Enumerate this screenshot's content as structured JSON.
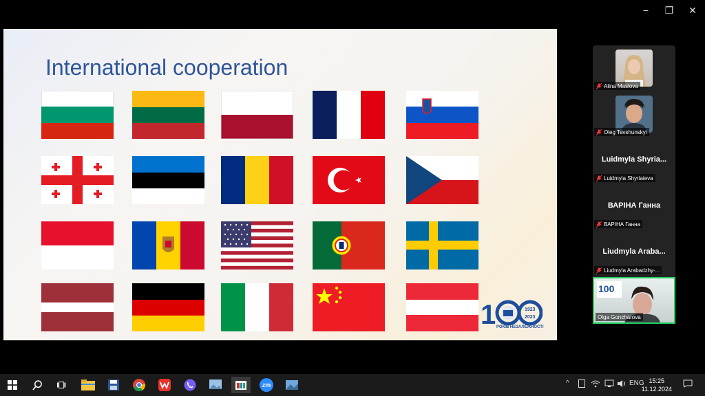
{
  "window": {
    "minimize_glyph": "−",
    "restore_glyph": "❐",
    "close_glyph": "✕"
  },
  "slide": {
    "title": "International cooperation",
    "flags": [
      "bulgaria-flag",
      "lithuania-flag",
      "poland-flag",
      "france-flag",
      "slovenia-flag",
      "georgia-flag",
      "estonia-flag",
      "romania-flag",
      "turkey-flag",
      "czech-flag",
      "monaco-flag",
      "moldova-flag",
      "usa-flag",
      "portugal-flag",
      "sweden-flag",
      "latvia-flag",
      "germany-flag",
      "italy-flag",
      "china-flag",
      "austria-flag"
    ],
    "logo": {
      "years_top": "1923",
      "years_bottom": "2023",
      "caption": "РОКІВ НЕЗАЛЕЖНОСТІ"
    }
  },
  "participants": [
    {
      "name": "Alina Maslova",
      "muted": true,
      "has_photo": true
    },
    {
      "name": "Oleg Tavshunskyi",
      "muted": true,
      "has_photo": true
    },
    {
      "display": "Luidmyla Shyria...",
      "name": "Luidmyla Shyriaieva",
      "muted": true,
      "has_photo": false
    },
    {
      "display": "ВАРІНА Ганна",
      "name": "ВАРІНА Ганна",
      "muted": true,
      "has_photo": false
    },
    {
      "display": "Liudmyla Araba...",
      "name": "Liudmyla Arabadzhy-...",
      "muted": true,
      "has_photo": false
    }
  ],
  "active_speaker": {
    "name": "Olga Goncharova"
  },
  "taskbar": {
    "apps": [
      "windows-start-icon",
      "search-icon",
      "task-view-icon",
      "file-explorer-icon",
      "save-icon",
      "chrome-icon",
      "wps-icon",
      "viber-icon",
      "photos-icon",
      "video-editor-icon",
      "zoom-icon",
      "screen-icon"
    ],
    "zoom_label": "zm",
    "tray": {
      "chevron": "^",
      "lang": "ENG"
    },
    "time": "15:25",
    "date": "11.12.2024"
  }
}
